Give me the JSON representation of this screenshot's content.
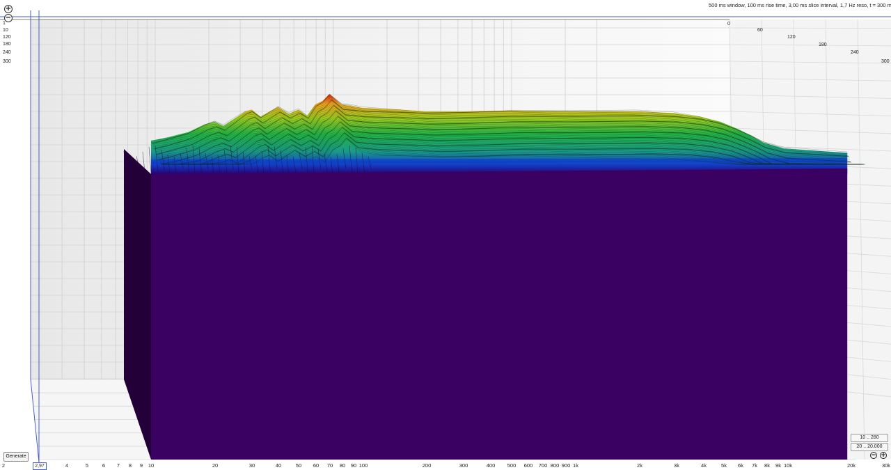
{
  "chart_data": {
    "type": "waterfall",
    "title": "500 ms window, 100 ms rise time, 3,00 ms slice interval, 1,7 Hz reso, t = 300 ms",
    "x_scale": "log",
    "x_ticks": [
      "2",
      "2,97",
      "4",
      "5",
      "6",
      "7",
      "8",
      "9",
      "10",
      "20",
      "30",
      "40",
      "50",
      "60",
      "70",
      "80",
      "90",
      "100",
      "200",
      "300",
      "400",
      "500",
      "600",
      "700",
      "800",
      "900",
      "1k",
      "2k",
      "3k",
      "4k",
      "5k",
      "6k",
      "7k",
      "8k",
      "9k",
      "10k",
      "20k",
      "30k"
    ],
    "left_axis_labels": [
      "1",
      "10",
      "120",
      "180",
      "240",
      "300"
    ],
    "depth_ticks": [
      "0",
      "60",
      "120",
      "180",
      "240"
    ],
    "visible_x_range": "10 .. 20k",
    "colors": {
      "front_wall": "#3a0062",
      "side_wall": "#230038",
      "grid": "#c8c8c8",
      "cursor": "#4a5ccc"
    },
    "surface_profile": [
      [
        10,
        0.16
      ],
      [
        12,
        0.2
      ],
      [
        15,
        0.26
      ],
      [
        18,
        0.35
      ],
      [
        20,
        0.38
      ],
      [
        22,
        0.33
      ],
      [
        25,
        0.42
      ],
      [
        28,
        0.5
      ],
      [
        30,
        0.52
      ],
      [
        33,
        0.44
      ],
      [
        36,
        0.49
      ],
      [
        40,
        0.55
      ],
      [
        45,
        0.47
      ],
      [
        50,
        0.52
      ],
      [
        55,
        0.45
      ],
      [
        60,
        0.58
      ],
      [
        65,
        0.62
      ],
      [
        70,
        0.7
      ],
      [
        80,
        0.58
      ],
      [
        90,
        0.56
      ],
      [
        100,
        0.54
      ],
      [
        150,
        0.52
      ],
      [
        200,
        0.5
      ],
      [
        300,
        0.5
      ],
      [
        500,
        0.51
      ],
      [
        1000,
        0.5
      ],
      [
        2000,
        0.5
      ],
      [
        3000,
        0.48
      ],
      [
        4000,
        0.44
      ],
      [
        5000,
        0.38
      ],
      [
        6000,
        0.3
      ],
      [
        7000,
        0.22
      ],
      [
        8000,
        0.14
      ],
      [
        10000,
        0.07
      ],
      [
        20000,
        0.02
      ]
    ]
  },
  "ui": {
    "zoom_in_icon": "plus-circle-icon",
    "zoom_out_icon": "minus-circle-icon",
    "generate_label": "Generate",
    "cursor_value": "2,97",
    "zoom_range_a": "10 .. 280",
    "zoom_range_b": "20 .. 20.000"
  }
}
